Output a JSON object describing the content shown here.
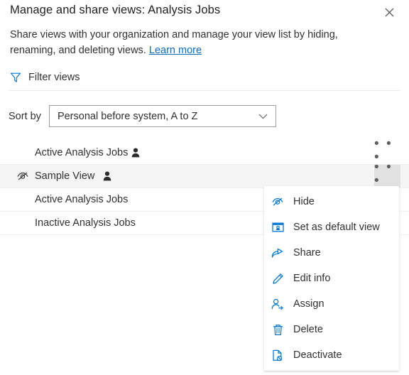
{
  "dialog": {
    "title": "Manage and share views: Analysis Jobs",
    "close_icon": "close-icon",
    "description_part1": "Share views with your organization and manage your view list by hiding, renaming, and deleting views.",
    "learn_more_label": "Learn more"
  },
  "filter": {
    "icon": "filter-icon",
    "label": "Filter views"
  },
  "sort": {
    "label": "Sort by",
    "selected_value": "Personal before system, A to Z",
    "chevron_icon": "chevron-down-icon"
  },
  "views": [
    {
      "name": "Active Analysis Jobs",
      "hidden": false,
      "personal": true,
      "hovered": false,
      "more_label": "• • •"
    },
    {
      "name": "Sample View",
      "hidden": true,
      "personal": true,
      "hovered": true,
      "more_label": "• • •"
    },
    {
      "name": "Active Analysis Jobs",
      "hidden": false,
      "personal": false,
      "hovered": false,
      "more_label": "• • •"
    },
    {
      "name": "Inactive Analysis Jobs",
      "hidden": false,
      "personal": false,
      "hovered": false,
      "more_label": "• • •"
    }
  ],
  "context_menu": {
    "items": [
      {
        "label": "Hide",
        "icon": "hide-eye-icon"
      },
      {
        "label": "Set as default view",
        "icon": "set-default-view-icon"
      },
      {
        "label": "Share",
        "icon": "share-icon"
      },
      {
        "label": "Edit info",
        "icon": "pencil-icon"
      },
      {
        "label": "Assign",
        "icon": "assign-person-icon"
      },
      {
        "label": "Delete",
        "icon": "trash-icon"
      },
      {
        "label": "Deactivate",
        "icon": "deactivate-file-icon"
      }
    ]
  },
  "colors": {
    "accent": "#0f6cbd",
    "icon_blue": "#0078d4",
    "text": "#323130",
    "hover_row": "#f5f5f5",
    "border": "#a19f9d"
  }
}
